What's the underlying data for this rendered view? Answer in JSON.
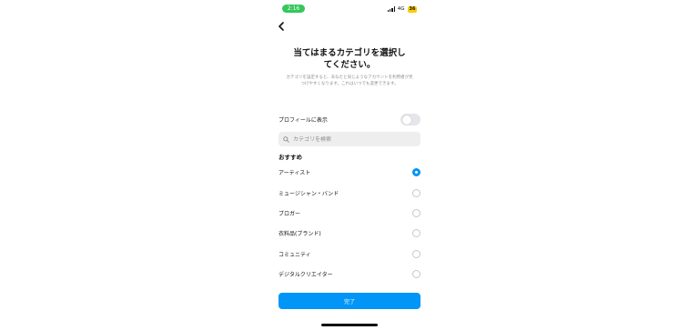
{
  "status": {
    "time": "2:16",
    "network": "4G",
    "battery": "36"
  },
  "header": {
    "title_line1": "当てはまるカテゴリを選択し",
    "title_line2": "てください。",
    "description": "カテゴリを設定すると、あなたと同じようなアカウントを利用者が見つけやすくなります。これはいつでも変更できます。"
  },
  "profile_toggle": {
    "label": "プロフィールに表示",
    "on": false
  },
  "search": {
    "placeholder": "カテゴリを検索"
  },
  "section_label": "おすすめ",
  "categories": [
    {
      "label": "アーティスト",
      "selected": true
    },
    {
      "label": "ミュージシャン・バンド",
      "selected": false
    },
    {
      "label": "ブロガー",
      "selected": false
    },
    {
      "label": "衣料品(ブランド)",
      "selected": false
    },
    {
      "label": "コミュニティ",
      "selected": false
    },
    {
      "label": "デジタルクリエイター",
      "selected": false
    }
  ],
  "done_button": "完了",
  "colors": {
    "accent": "#0095f6",
    "status_green": "#34c759",
    "battery": "#ffcc00"
  }
}
